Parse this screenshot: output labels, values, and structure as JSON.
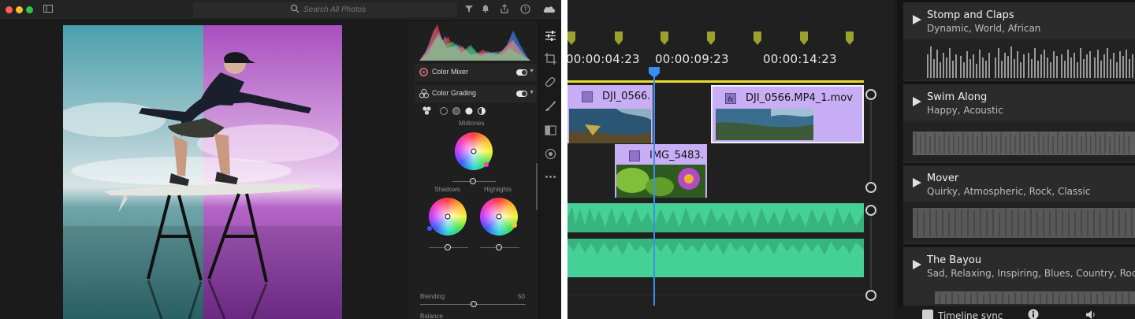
{
  "photo_editor": {
    "search": {
      "placeholder": "Search All Photos"
    },
    "panels": {
      "color_mixer": {
        "label": "Color Mixer"
      },
      "color_grading": {
        "label": "Color Grading",
        "midtones_label": "Midtones",
        "shadows_label": "Shadows",
        "highlights_label": "Highlights",
        "blending_label": "Blending",
        "blending_value": "50",
        "balance_label": "Balance"
      }
    },
    "tools": [
      "sliders-icon",
      "crop-icon",
      "heal-icon",
      "brush-icon",
      "gradient-icon",
      "radial-icon",
      "more-icon"
    ]
  },
  "video_editor": {
    "timecodes": [
      "00:00:04:23",
      "00:00:09:23",
      "00:00:14:23"
    ],
    "clips": [
      {
        "title": "DJI_0566."
      },
      {
        "fx": "fx",
        "title": "DJI_0566.MP4_1.mov"
      },
      {
        "title": "IMG_5483."
      }
    ],
    "songs": [
      {
        "title": "Stomp and Claps",
        "tags": "Dynamic, World, African"
      },
      {
        "title": "Swim Along",
        "tags": "Happy, Acoustic"
      },
      {
        "title": "Mover",
        "tags": "Quirky, Atmospheric, Rock, Classic"
      },
      {
        "title": "The Bayou",
        "tags": "Sad, Relaxing, Inspiring, Blues, Country, Rock,"
      }
    ],
    "timeline_sync_label": "Timeline sync"
  },
  "colors": {
    "clip_purple": "#c7aef5",
    "audio_green": "#45d195",
    "playhead_blue": "#3a8ef0",
    "marker_olive": "#9aa12c",
    "in_out_yellow": "#e9df2a"
  }
}
